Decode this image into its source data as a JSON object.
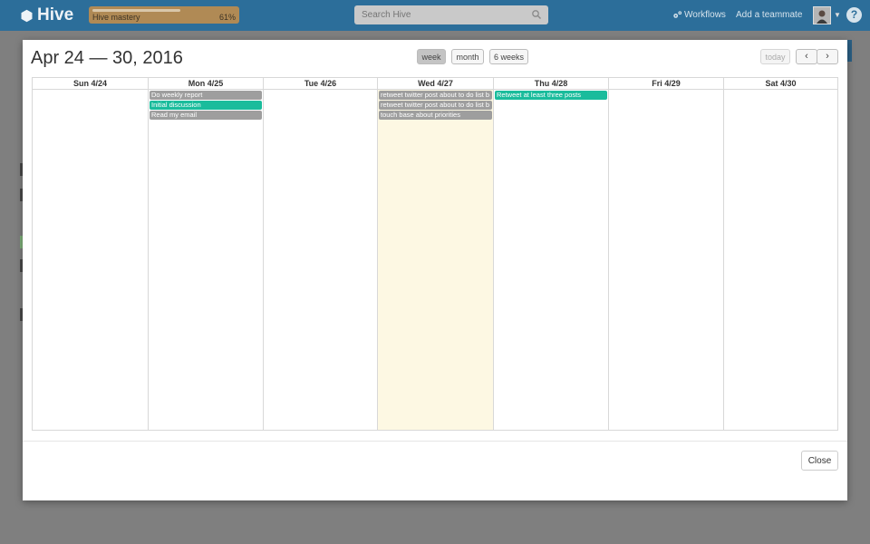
{
  "app": {
    "name": "Hive",
    "mastery_label": "Hive mastery",
    "mastery_percent": "61%",
    "mastery_fraction": 0.61,
    "search_placeholder": "Search Hive",
    "workflows_label": "Workflows",
    "add_teammate_label": "Add a teammate",
    "help_label": "?"
  },
  "modal": {
    "title": "Apr 24 — 30, 2016",
    "views": [
      {
        "label": "week",
        "active": true
      },
      {
        "label": "month",
        "active": false
      },
      {
        "label": "6 weeks",
        "active": false
      }
    ],
    "today_label": "today",
    "prev_glyph": "‹",
    "next_glyph": "›",
    "close_label": "Close"
  },
  "calendar": {
    "today_index": 3,
    "days": [
      {
        "label": "Sun 4/24",
        "events": []
      },
      {
        "label": "Mon 4/25",
        "events": [
          {
            "title": "Do weekly report",
            "color": "#9e9e9e"
          },
          {
            "title": "Initial discussion",
            "color": "#1abc9c"
          },
          {
            "title": "Read my email",
            "color": "#9e9e9e"
          }
        ]
      },
      {
        "label": "Tue 4/26",
        "events": []
      },
      {
        "label": "Wed 4/27",
        "events": [
          {
            "title": "retweet twitter post about to do list b",
            "color": "#9e9e9e"
          },
          {
            "title": "retweet twitter post about to do list b",
            "color": "#9e9e9e"
          },
          {
            "title": "touch base about priorities",
            "color": "#9e9e9e"
          }
        ]
      },
      {
        "label": "Thu 4/28",
        "events": [
          {
            "title": "Retweet at least three posts",
            "color": "#1abc9c"
          }
        ]
      },
      {
        "label": "Fri 4/29",
        "events": []
      },
      {
        "label": "Sat 4/30",
        "events": []
      }
    ]
  }
}
